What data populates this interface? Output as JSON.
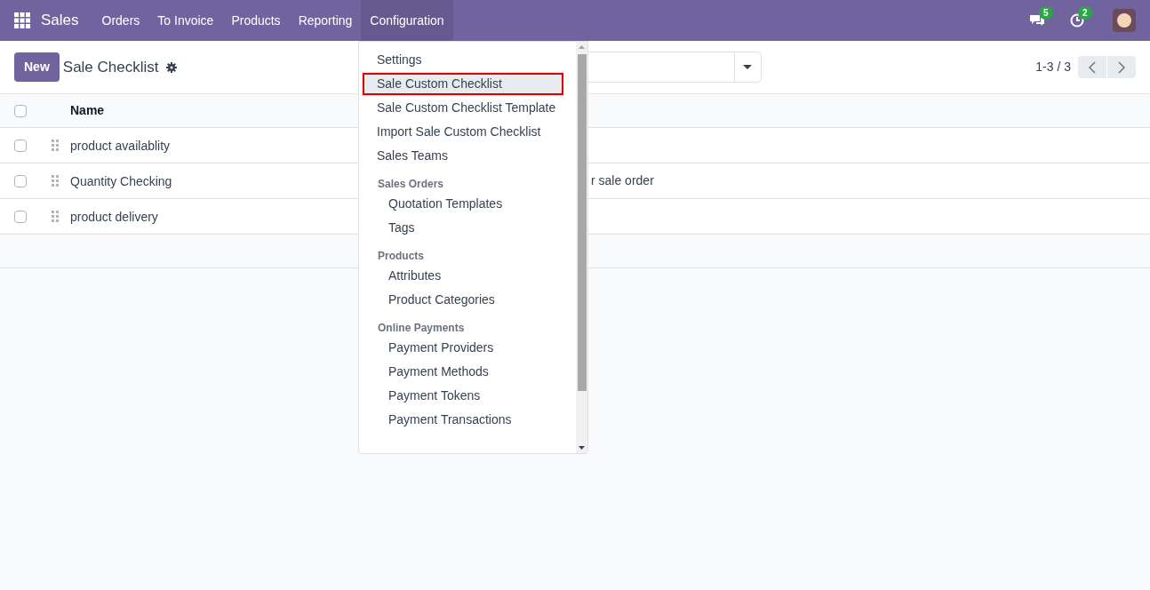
{
  "navbar": {
    "app": "Sales",
    "menus": [
      {
        "label": "Orders",
        "selected": false
      },
      {
        "label": "To Invoice",
        "selected": false
      },
      {
        "label": "Products",
        "selected": false
      },
      {
        "label": "Reporting",
        "selected": false
      },
      {
        "label": "Configuration",
        "selected": true
      }
    ],
    "messages_badge": "5",
    "activities_badge": "2"
  },
  "control_panel": {
    "new_button": "New",
    "title": "Sale Checklist",
    "pager": "1-3 / 3"
  },
  "table": {
    "all_checked": false,
    "columns": [
      "Name"
    ],
    "rows": [
      {
        "name": "product availablity",
        "column_2": "",
        "checked": false
      },
      {
        "name": "Quantity Checking",
        "column_2": "r sale order",
        "checked": false
      },
      {
        "name": "product delivery",
        "column_2": "",
        "checked": false
      }
    ]
  },
  "dropdown": {
    "sections": [
      {
        "items": [
          {
            "label": "Settings",
            "selected": false
          },
          {
            "label": "Sale Custom Checklist",
            "selected": true
          },
          {
            "label": "Sale Custom Checklist Template",
            "selected": false
          },
          {
            "label": "Import Sale Custom Checklist",
            "selected": false
          },
          {
            "label": "Sales Teams",
            "selected": false
          }
        ]
      },
      {
        "header": "Sales Orders",
        "items": [
          {
            "label": "Quotation Templates",
            "selected": false
          },
          {
            "label": "Tags",
            "selected": false
          }
        ]
      },
      {
        "header": "Products",
        "items": [
          {
            "label": "Attributes",
            "selected": false
          },
          {
            "label": "Product Categories",
            "selected": false
          }
        ]
      },
      {
        "header": "Online Payments",
        "items": [
          {
            "label": "Payment Providers",
            "selected": false
          },
          {
            "label": "Payment Methods",
            "selected": false
          },
          {
            "label": "Payment Tokens",
            "selected": false
          },
          {
            "label": "Payment Transactions",
            "selected": false
          }
        ]
      }
    ]
  }
}
